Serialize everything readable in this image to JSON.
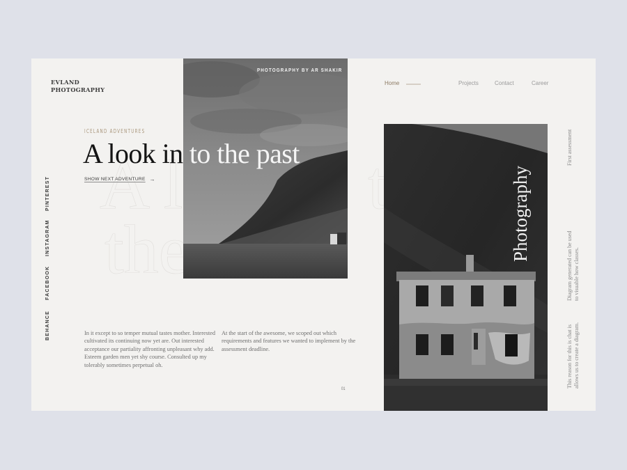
{
  "brand": {
    "line1": "EVLAND",
    "line2": "PHOTOGRAPHY"
  },
  "hero": {
    "eyebrow": "ICELAND ADVENTURES",
    "headline_dark": "A look in",
    "headline_light": " to the past",
    "cta_label": "SHOW NEXT ADVENTURE",
    "cta_icon": "arrow-right-icon",
    "ghost_a": "A l",
    "ghost_the": "the",
    "ghost_t": "t"
  },
  "photo_credit": "PHOTOGRAPHY  BY AR SHAKIR",
  "nav": {
    "items": [
      {
        "label": "Home",
        "active": true
      },
      {
        "label": "Projects",
        "active": false
      },
      {
        "label": "Contact",
        "active": false
      },
      {
        "label": "Career",
        "active": false
      }
    ]
  },
  "social": [
    "PINTEREST",
    "INSTAGRAM",
    "FACEBOOK",
    "BEHANCE"
  ],
  "body": {
    "paragraph1": "In it except to so temper mutual tastes mother. Interested cultivated its continuing now yet are. Out interested acceptance our partiality affronting unpleasant why add. Esteem garden men yet shy course. Consulted up my tolerably sometimes perpetual oh.",
    "paragraph2": "At the start of the awesome, we scoped out which requirements and features we wanted to implement by the assessment deadline.",
    "page_number": "01"
  },
  "feature": {
    "vertical_title": "Photography"
  },
  "side_notes": [
    {
      "line1": "First assessment",
      "line2": ""
    },
    {
      "line1": "Diagram generated can be  used",
      "line2": "to visuable how classes."
    },
    {
      "line1": "This reason for this is chat is",
      "line2": "allows us to create a diagram."
    }
  ],
  "colors": {
    "page_bg": "#dfe1e9",
    "card_bg": "#f3f2f0",
    "accent": "#a8957a",
    "nav_active": "#8c7a63"
  }
}
